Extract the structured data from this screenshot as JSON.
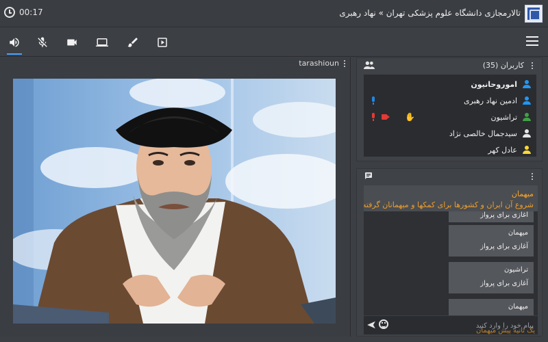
{
  "header": {
    "timer": "00:17",
    "title": "تالارمجازی دانشگاه علوم پزشکی تهران » نهاد رهبری"
  },
  "toolbar": {
    "tools": [
      "volume-icon",
      "mic-off-icon",
      "camera-icon",
      "screen-share-icon",
      "brush-icon",
      "play-icon"
    ],
    "active": "volume-icon",
    "menu": "menu-icon"
  },
  "video": {
    "presenter": "tarashioun"
  },
  "users": {
    "title": "کاربران (35)",
    "items": [
      {
        "name": "اموروحانیون",
        "color": "#2196f3"
      },
      {
        "name": "ادمین نهاد رهبری",
        "color": "#2196f3"
      },
      {
        "name": "تراشیون",
        "color": "#43a047"
      },
      {
        "name": "سیدجمال خالصی نژاد",
        "color": "#e6e6e6"
      },
      {
        "name": "عادل کهر",
        "color": "#fdd835"
      }
    ],
    "status_colors": {
      "mic_on": "#1e88e5",
      "mic_muted": "#e53935",
      "cam_off": "#e53935"
    }
  },
  "chat": {
    "pinned_name": "میهمان",
    "pinned_text": "شروع آن ایران و کشورها برای کمکها و میهمانان گرفته",
    "messages": [
      {
        "name": "",
        "text": "آغازی برای پرواز"
      },
      {
        "name": "میهمان",
        "text": "آغازی برای پرواز"
      },
      {
        "name": "تراشیون",
        "text": "آغازی برای پرواز"
      },
      {
        "name": "میهمان",
        "text": ""
      }
    ],
    "placeholder": "پیام خود را وارد کنید",
    "footer": "یک ثانیه پیش میهمان"
  }
}
